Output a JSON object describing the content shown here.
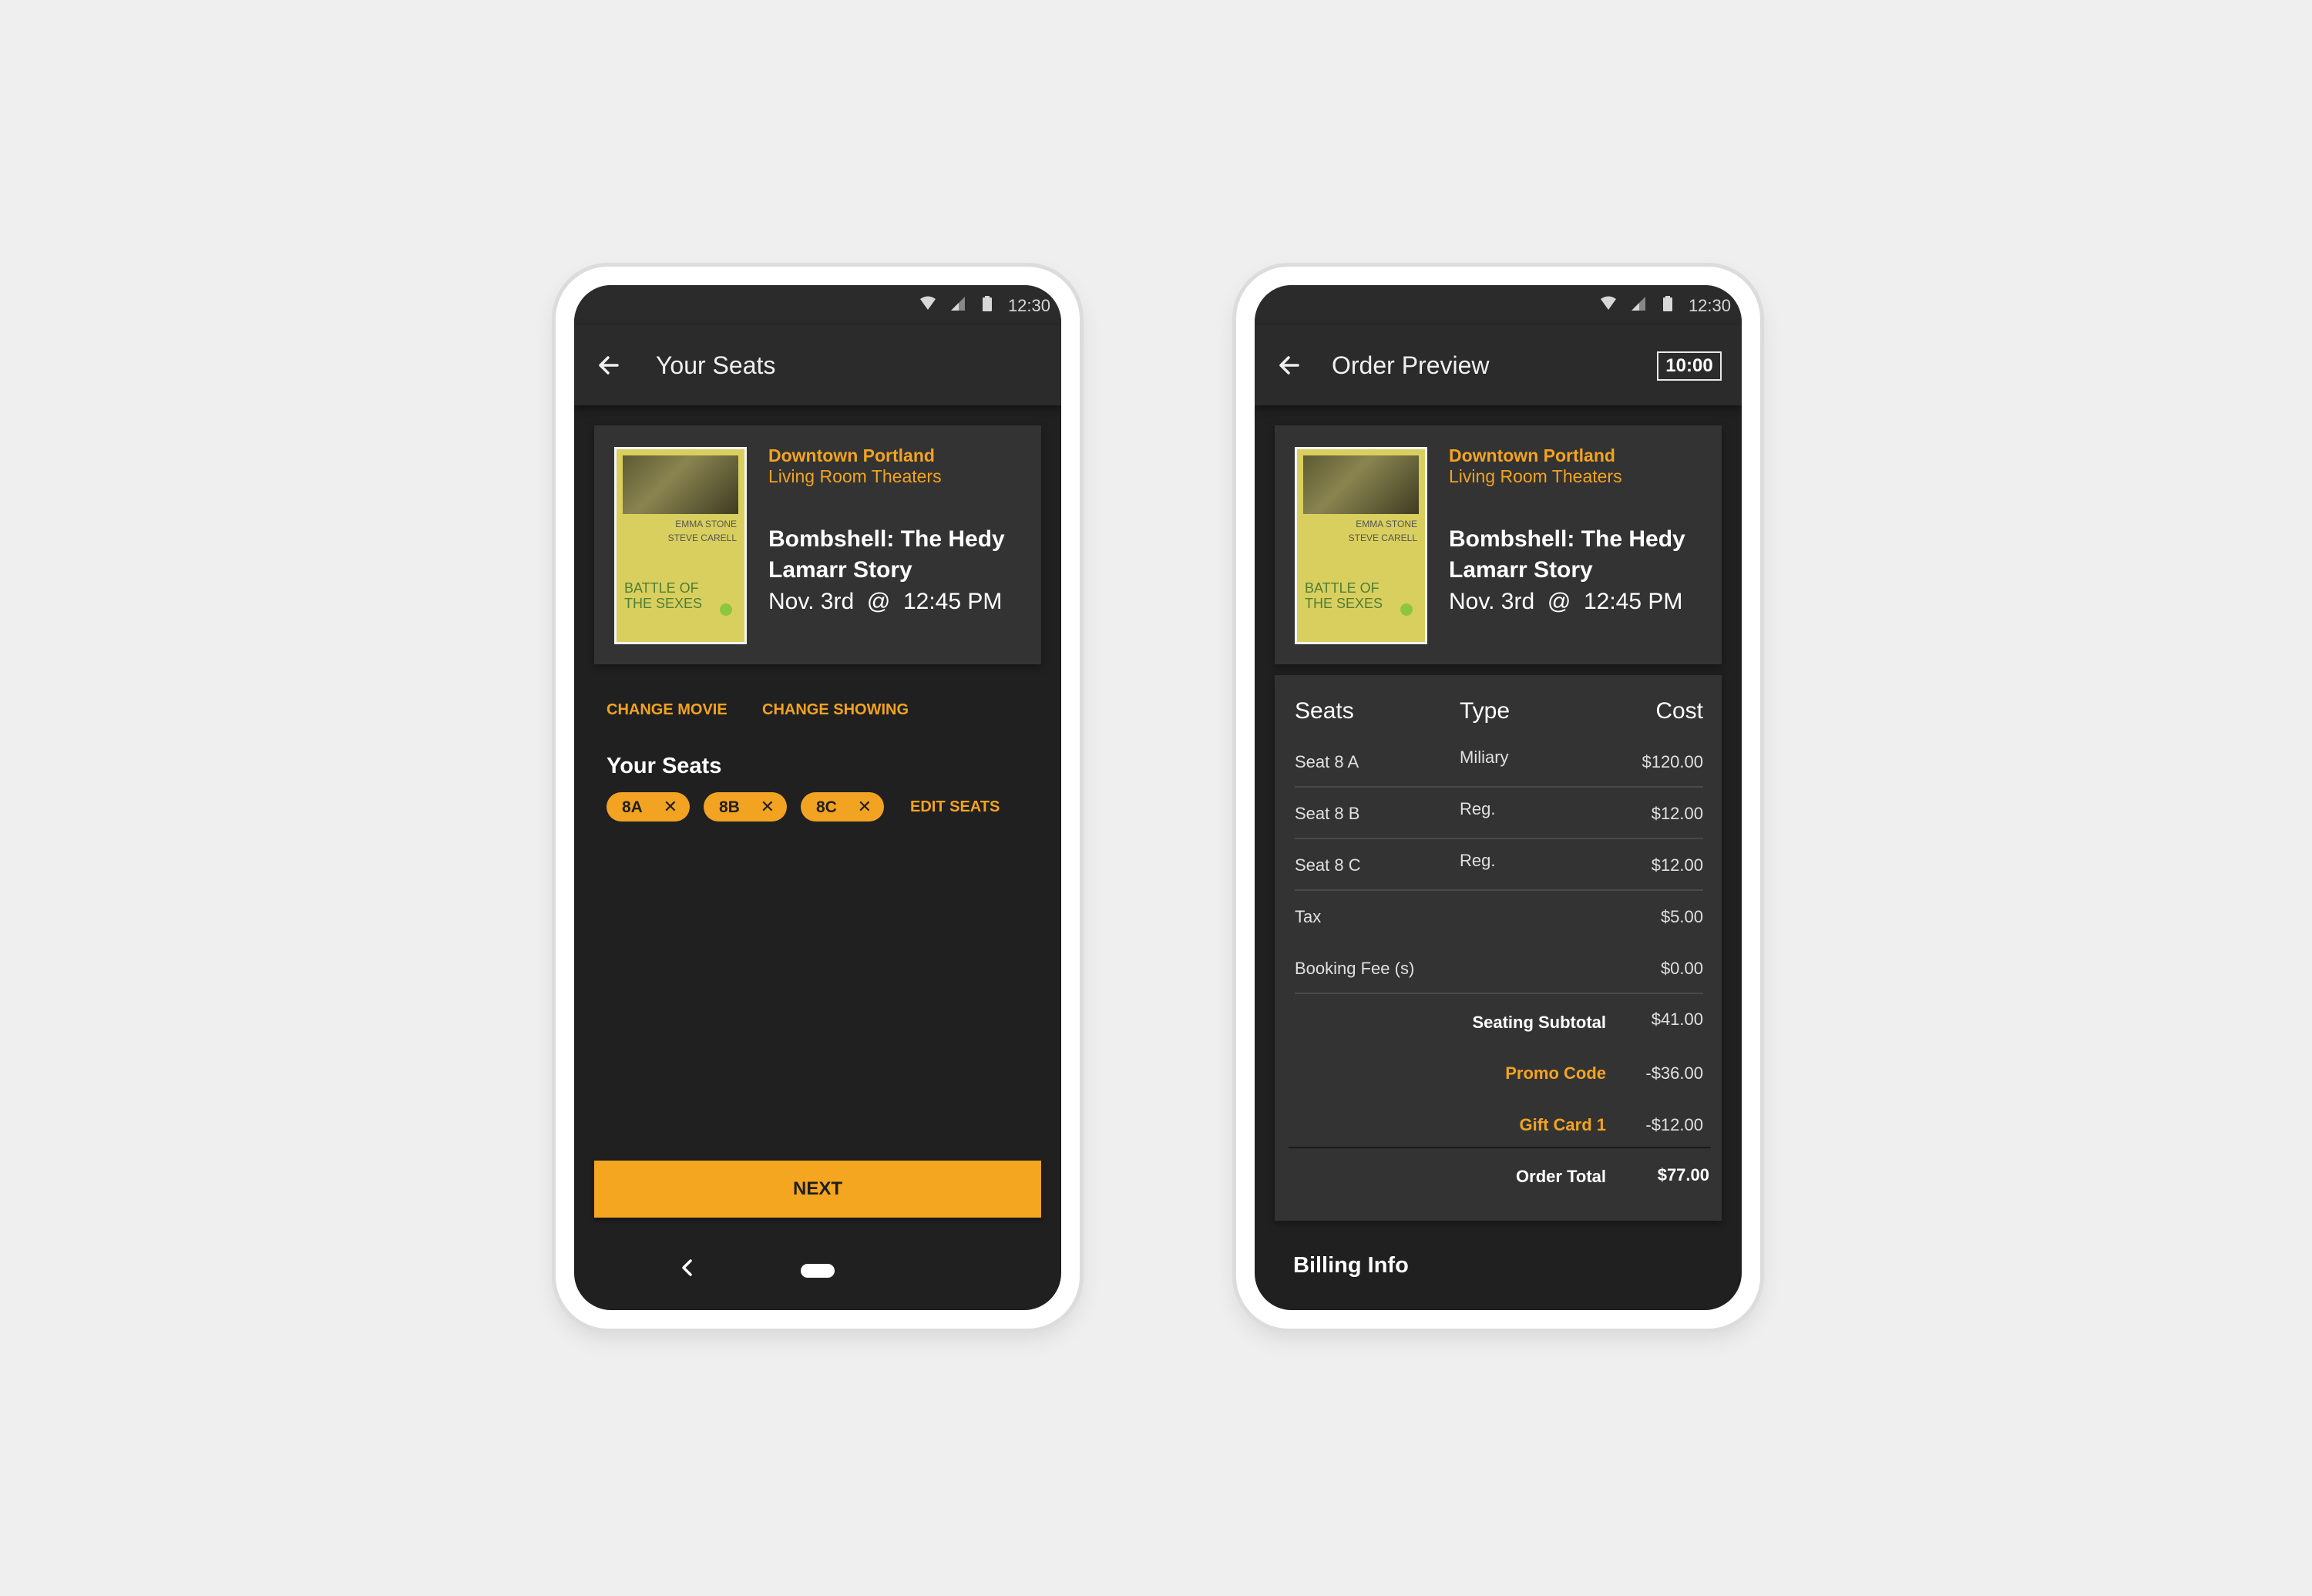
{
  "status_bar": {
    "time": "12:30"
  },
  "movie": {
    "venue": "Downtown Portland",
    "theater": "Living Room Theaters",
    "title": "Bombshell: The Hedy Lamarr Story",
    "date": "Nov. 3rd",
    "at": "@",
    "time": "12:45 PM",
    "poster": {
      "names_line1": "EMMA STONE",
      "names_line2": "STEVE CARELL",
      "title_line1": "BATTLE OF",
      "title_line2": "THE SEXES"
    }
  },
  "seats_screen": {
    "title": "Your Seats",
    "change_movie": "CHANGE MOVIE",
    "change_showing": "CHANGE SHOWING",
    "section_title": "Your Seats",
    "seats": [
      "8A",
      "8B",
      "8C"
    ],
    "remove_glyph": "✕",
    "edit_seats": "EDIT SEATS",
    "next": "NEXT"
  },
  "order_screen": {
    "title": "Order Preview",
    "timer": "10:00",
    "headers": {
      "seats": "Seats",
      "type": "Type",
      "cost": "Cost"
    },
    "lines": [
      {
        "seat": "Seat 8 A",
        "type": "Miliary",
        "cost": "$120.00"
      },
      {
        "seat": "Seat 8 B",
        "type": "Reg.",
        "cost": "$12.00"
      },
      {
        "seat": "Seat 8 C",
        "type": "Reg.",
        "cost": "$12.00"
      }
    ],
    "tax": {
      "label": "Tax",
      "value": "$5.00"
    },
    "booking_fee": {
      "label": "Booking Fee (s)",
      "value": "$0.00"
    },
    "subtotal": {
      "label": "Seating Subtotal",
      "value": "$41.00"
    },
    "promo": {
      "label": "Promo Code",
      "value": "-$36.00"
    },
    "gift_card": {
      "label": "Gift Card 1",
      "value": "-$12.00"
    },
    "total": {
      "label": "Order Total",
      "value": "$77.00"
    },
    "billing_title": "Billing Info"
  },
  "colors": {
    "accent": "#f2a321",
    "background": "#202020",
    "card": "#333333",
    "page": "#efefef"
  },
  "icons": [
    "wifi-icon",
    "signal-icon",
    "battery-icon",
    "back-arrow-icon",
    "close-icon",
    "nav-back-icon",
    "home-pill-icon"
  ]
}
